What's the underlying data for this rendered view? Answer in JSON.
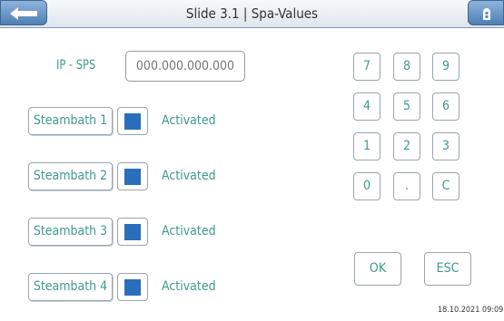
{
  "header": {
    "title": "Slide 3.1 | Spa-Values"
  },
  "ip": {
    "label": "IP - SPS",
    "placeholder": "000.000.000.000"
  },
  "steambaths": [
    {
      "label": "Steambath 1",
      "status": "Activated"
    },
    {
      "label": "Steambath 2",
      "status": "Activated"
    },
    {
      "label": "Steambath 3",
      "status": "Activated"
    },
    {
      "label": "Steambath 4",
      "status": "Activated"
    }
  ],
  "keypad": {
    "keys": [
      "7",
      "8",
      "9",
      "4",
      "5",
      "6",
      "1",
      "2",
      "3",
      "0",
      ".",
      "C"
    ],
    "ok": "OK",
    "esc": "ESC"
  },
  "footer": {
    "timestamp": "18.10.2021 09:09:00"
  },
  "colors": {
    "accent": "#3f9a8c",
    "toggle": "#2a6ebb",
    "header_button": "#5a87b9"
  },
  "icons": {
    "back": "back-arrow-icon",
    "menu": "menu-icon"
  }
}
